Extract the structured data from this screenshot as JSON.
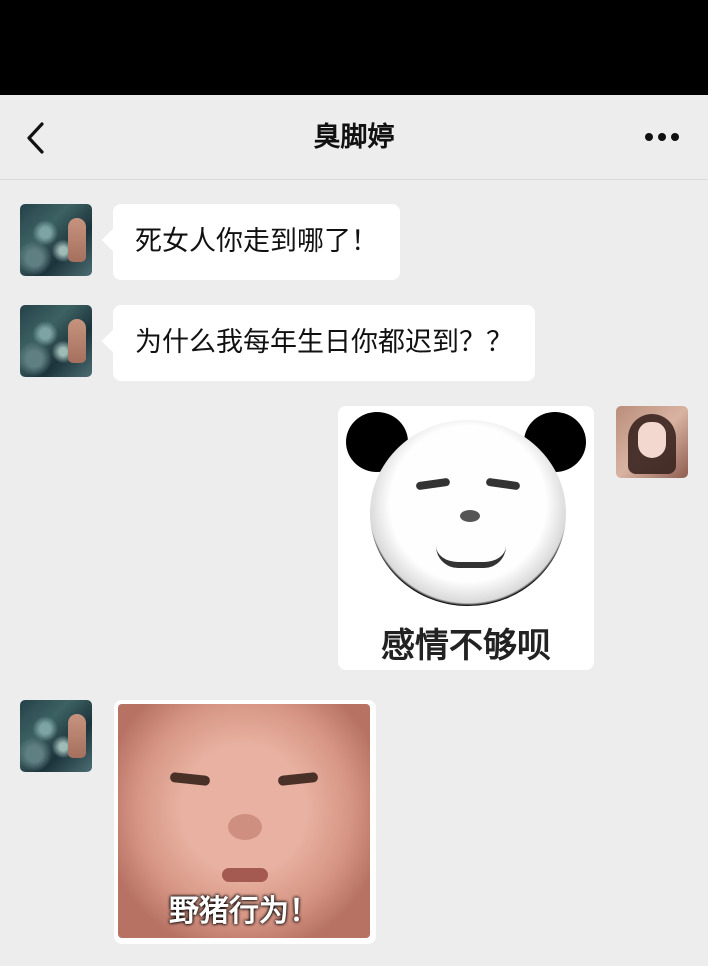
{
  "header": {
    "title": "臭脚婷",
    "back_icon": "chevron-left-icon",
    "more_icon": "ellipsis-icon"
  },
  "messages": [
    {
      "sender": "other",
      "type": "text",
      "text": "死女人你走到哪了！"
    },
    {
      "sender": "other",
      "type": "text",
      "text": "为什么我每年生日你都迟到？？"
    },
    {
      "sender": "me",
      "type": "sticker",
      "caption": "感情不够呗"
    },
    {
      "sender": "other",
      "type": "sticker",
      "caption": "野猪行为！"
    }
  ]
}
